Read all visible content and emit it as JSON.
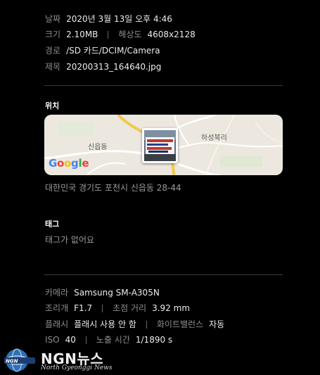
{
  "details": {
    "date": {
      "label": "날짜",
      "value": "2020년 3월 13일 오후 4:46"
    },
    "size": {
      "label": "크기",
      "value": "2.10MB"
    },
    "resolution": {
      "label": "해상도",
      "value": "4608x2128"
    },
    "path": {
      "label": "경로",
      "value": "/SD 카드/DCIM/Camera"
    },
    "title": {
      "label": "제목",
      "value": "20200313_164640.jpg"
    }
  },
  "location": {
    "heading": "위치",
    "map_labels": {
      "west": "신읍동",
      "east": "하성북리"
    },
    "map_brand": "Google",
    "address": "대한민국 경기도 포천시 신읍동 28-44"
  },
  "tags": {
    "heading": "태그",
    "empty_text": "태그가 없어요"
  },
  "camera": {
    "model": {
      "label": "카메라",
      "value": "Samsung SM-A305N"
    },
    "aperture": {
      "label": "조리개",
      "value": "F1.7"
    },
    "focal": {
      "label": "초점 거리",
      "value": "3.92 mm"
    },
    "flash": {
      "label": "플래시",
      "value": "플래시 사용 안 함"
    },
    "white_balance": {
      "label": "화이트밸런스",
      "value": "자동"
    },
    "iso": {
      "label": "ISO",
      "value": "40"
    },
    "exposure": {
      "label": "노출 시간",
      "value": "1/1890 s"
    }
  },
  "watermark": {
    "name": "NGN뉴스",
    "subtitle": "North Gyeonggi News",
    "badge": "NGN"
  },
  "colors": {
    "background": "#000000",
    "label": "#8c8c8c",
    "value": "#ececec",
    "divider": "#3a3a3a",
    "map_bg": "#ece8df",
    "road_yellow": "#f2c94c"
  }
}
